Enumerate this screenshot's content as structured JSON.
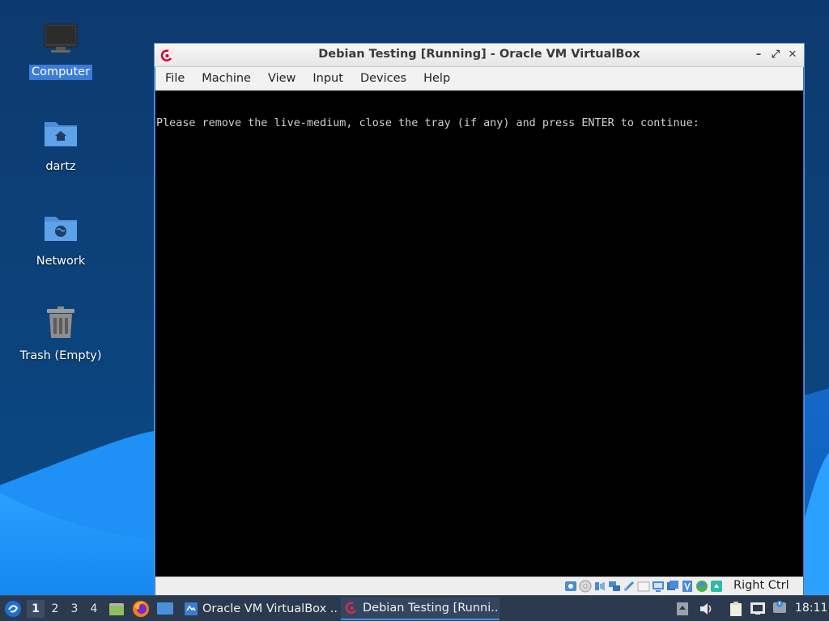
{
  "desktop": {
    "icons": [
      {
        "label": "Computer",
        "icon": "computer-icon",
        "selected": true
      },
      {
        "label": "dartz",
        "icon": "home-folder-icon"
      },
      {
        "label": "Network",
        "icon": "network-folder-icon"
      },
      {
        "label": "Trash (Empty)",
        "icon": "trash-icon"
      }
    ]
  },
  "window": {
    "title": "Debian Testing [Running] - Oracle VM VirtualBox",
    "controls": {
      "minimize": "–",
      "maximize": "⤢",
      "close": "✕"
    },
    "menu": [
      "File",
      "Machine",
      "View",
      "Input",
      "Devices",
      "Help"
    ],
    "console_text": "Please remove the live-medium, close the tray (if any) and press ENTER to continue:",
    "statusbar": {
      "icons": [
        "hard-disk-icon",
        "optical-drive-icon",
        "audio-icon",
        "network-icon",
        "usb-icon",
        "shared-folders-icon",
        "display-icon",
        "recording-icon",
        "cpu-icon",
        "mouse-integration-icon",
        "keyboard-capture-icon"
      ],
      "host_key": "Right Ctrl"
    }
  },
  "taskbar": {
    "workspaces": [
      "1",
      "2",
      "3",
      "4"
    ],
    "active_workspace": "1",
    "tasks": [
      {
        "label": "Oracle VM VirtualBox ...",
        "icon": "virtualbox-icon",
        "active": false
      },
      {
        "label": "Debian Testing [Runni...",
        "icon": "debian-icon",
        "active": true
      }
    ],
    "clock": "18:11"
  },
  "colors": {
    "wallpaper_dark": "#0b3e73",
    "wallpaper_wave": "#1a8cf0",
    "accent": "#3d7bd9",
    "taskbar": "#2b3a4f"
  }
}
